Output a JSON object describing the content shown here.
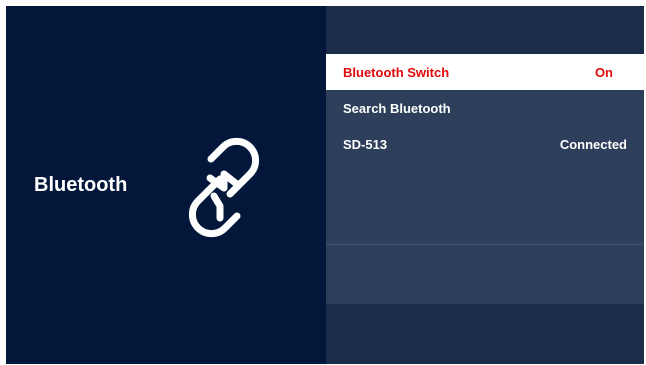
{
  "left": {
    "title": "Bluetooth",
    "icon": "bluetooth-link-icon"
  },
  "menu": {
    "items": [
      {
        "label": "Bluetooth Switch",
        "value": "On",
        "selected": true
      },
      {
        "label": "Search Bluetooth",
        "value": ""
      },
      {
        "label": "SD-513",
        "value": "Connected"
      }
    ]
  },
  "colors": {
    "left_bg": "#03173a",
    "right_bg": "#1b2c4b",
    "menu_bg": "#2d3f5a",
    "selected_bg": "#ffffff",
    "selected_text": "#e10a0a",
    "text": "#ffffff"
  }
}
